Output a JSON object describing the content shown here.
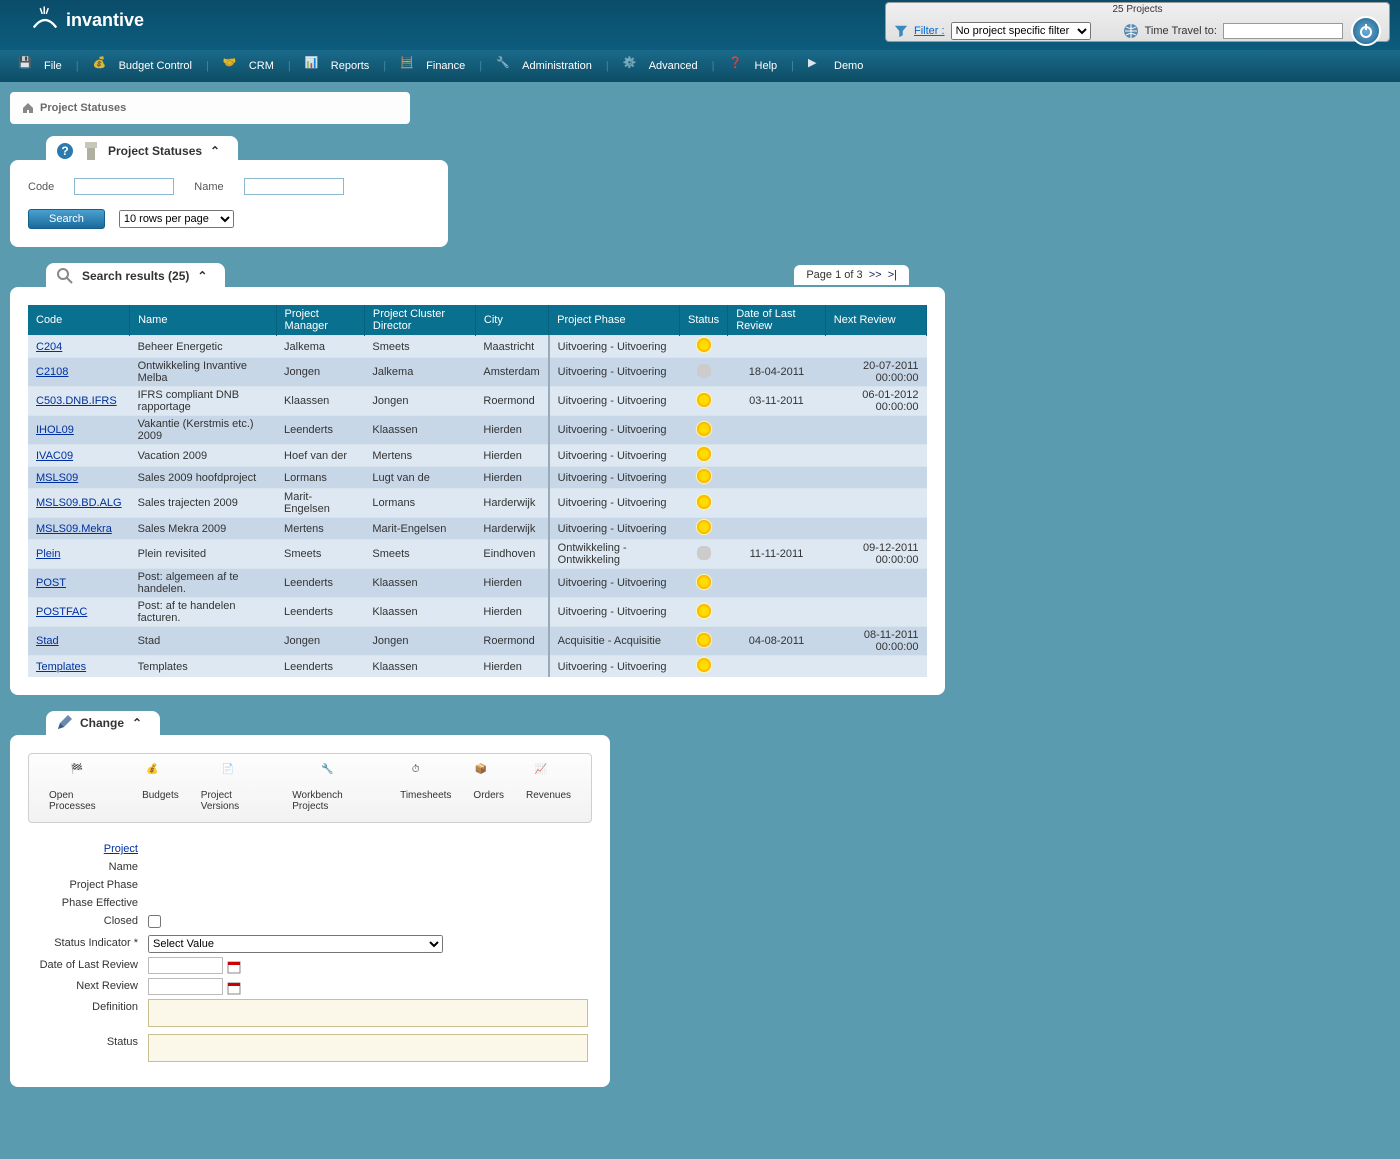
{
  "header": {
    "brand": "invantive",
    "projects_count": "25 Projects",
    "filter_label": "Filter :",
    "filter_value": "No project specific filter",
    "time_travel_label": "Time Travel to:"
  },
  "menu": [
    {
      "label": "File"
    },
    {
      "label": "Budget Control"
    },
    {
      "label": "CRM"
    },
    {
      "label": "Reports"
    },
    {
      "label": "Finance"
    },
    {
      "label": "Administration"
    },
    {
      "label": "Advanced"
    },
    {
      "label": "Help"
    },
    {
      "label": "Demo"
    }
  ],
  "breadcrumb": {
    "title": "Project Statuses"
  },
  "search_panel": {
    "title": "Project Statuses",
    "code_label": "Code",
    "name_label": "Name",
    "search_btn": "Search",
    "rows_per_page": "10 rows per page"
  },
  "results": {
    "tab_title": "Search results (25)",
    "pager": "Page 1 of 3",
    "pager_next": ">>",
    "pager_last": ">|",
    "columns": [
      "Code",
      "Name",
      "Project Manager",
      "Project Cluster Director",
      "City",
      "Project Phase",
      "Status",
      "Date of Last Review",
      "Next Review"
    ],
    "rows": [
      {
        "code": "C204",
        "name": "Beheer Energetic",
        "pm": "Jalkema",
        "pcd": "Smeets",
        "city": "Maastricht",
        "phase": "Uitvoering - Uitvoering",
        "status": "sun",
        "last": "",
        "next": ""
      },
      {
        "code": "C2108",
        "name": "Ontwikkeling Invantive Melba",
        "pm": "Jongen",
        "pcd": "Jalkema",
        "city": "Amsterdam",
        "phase": "Uitvoering - Uitvoering",
        "status": "cloud",
        "last": "18-04-2011",
        "next": "20-07-2011 00:00:00"
      },
      {
        "code": "C503.DNB.IFRS",
        "name": "IFRS compliant DNB rapportage",
        "pm": "Klaassen",
        "pcd": "Jongen",
        "city": "Roermond",
        "phase": "Uitvoering - Uitvoering",
        "status": "sun",
        "last": "03-11-2011",
        "next": "06-01-2012 00:00:00"
      },
      {
        "code": "IHOL09",
        "name": "Vakantie (Kerstmis etc.) 2009",
        "pm": "Leenderts",
        "pcd": "Klaassen",
        "city": "Hierden",
        "phase": "Uitvoering - Uitvoering",
        "status": "sun",
        "last": "",
        "next": ""
      },
      {
        "code": "IVAC09",
        "name": "Vacation 2009",
        "pm": "Hoef van der",
        "pcd": "Mertens",
        "city": "Hierden",
        "phase": "Uitvoering - Uitvoering",
        "status": "sun",
        "last": "",
        "next": ""
      },
      {
        "code": "MSLS09",
        "name": "Sales 2009 hoofdproject",
        "pm": "Lormans",
        "pcd": "Lugt van de",
        "city": "Hierden",
        "phase": "Uitvoering - Uitvoering",
        "status": "sun",
        "last": "",
        "next": ""
      },
      {
        "code": "MSLS09.BD.ALG",
        "name": "Sales trajecten 2009",
        "pm": "Marit-Engelsen",
        "pcd": "Lormans",
        "city": "Harderwijk",
        "phase": "Uitvoering - Uitvoering",
        "status": "sun",
        "last": "",
        "next": ""
      },
      {
        "code": "MSLS09.Mekra",
        "name": "Sales Mekra 2009",
        "pm": "Mertens",
        "pcd": "Marit-Engelsen",
        "city": "Harderwijk",
        "phase": "Uitvoering - Uitvoering",
        "status": "sun",
        "last": "",
        "next": ""
      },
      {
        "code": "Plein",
        "name": "Plein revisited",
        "pm": "Smeets",
        "pcd": "Smeets",
        "city": "Eindhoven",
        "phase": "Ontwikkeling - Ontwikkeling",
        "status": "cloud",
        "last": "11-11-2011",
        "next": "09-12-2011 00:00:00"
      },
      {
        "code": "POST",
        "name": "Post: algemeen af te handelen.",
        "pm": "Leenderts",
        "pcd": "Klaassen",
        "city": "Hierden",
        "phase": "Uitvoering - Uitvoering",
        "status": "sun",
        "last": "",
        "next": ""
      },
      {
        "code": "POSTFAC",
        "name": "Post: af te handelen facturen.",
        "pm": "Leenderts",
        "pcd": "Klaassen",
        "city": "Hierden",
        "phase": "Uitvoering - Uitvoering",
        "status": "sun",
        "last": "",
        "next": ""
      },
      {
        "code": "Stad",
        "name": "Stad",
        "pm": "Jongen",
        "pcd": "Jongen",
        "city": "Roermond",
        "phase": "Acquisitie - Acquisitie",
        "status": "sun",
        "last": "04-08-2011",
        "next": "08-11-2011 00:00:00"
      },
      {
        "code": "Templates",
        "name": "Templates",
        "pm": "Leenderts",
        "pcd": "Klaassen",
        "city": "Hierden",
        "phase": "Uitvoering - Uitvoering",
        "status": "sun",
        "last": "",
        "next": ""
      }
    ]
  },
  "change_panel": {
    "title": "Change",
    "toolbar": [
      {
        "label": "Open Processes"
      },
      {
        "label": "Budgets"
      },
      {
        "label": "Project Versions"
      },
      {
        "label": "Workbench Projects"
      },
      {
        "label": "Timesheets"
      },
      {
        "label": "Orders"
      },
      {
        "label": "Revenues"
      }
    ],
    "fields": {
      "project": "Project",
      "name": "Name",
      "project_phase": "Project Phase",
      "phase_effective": "Phase Effective",
      "closed": "Closed",
      "status_indicator": "Status Indicator *",
      "status_indicator_value": "Select Value",
      "date_last_review": "Date of Last Review",
      "next_review": "Next Review",
      "definition": "Definition",
      "status": "Status"
    }
  }
}
